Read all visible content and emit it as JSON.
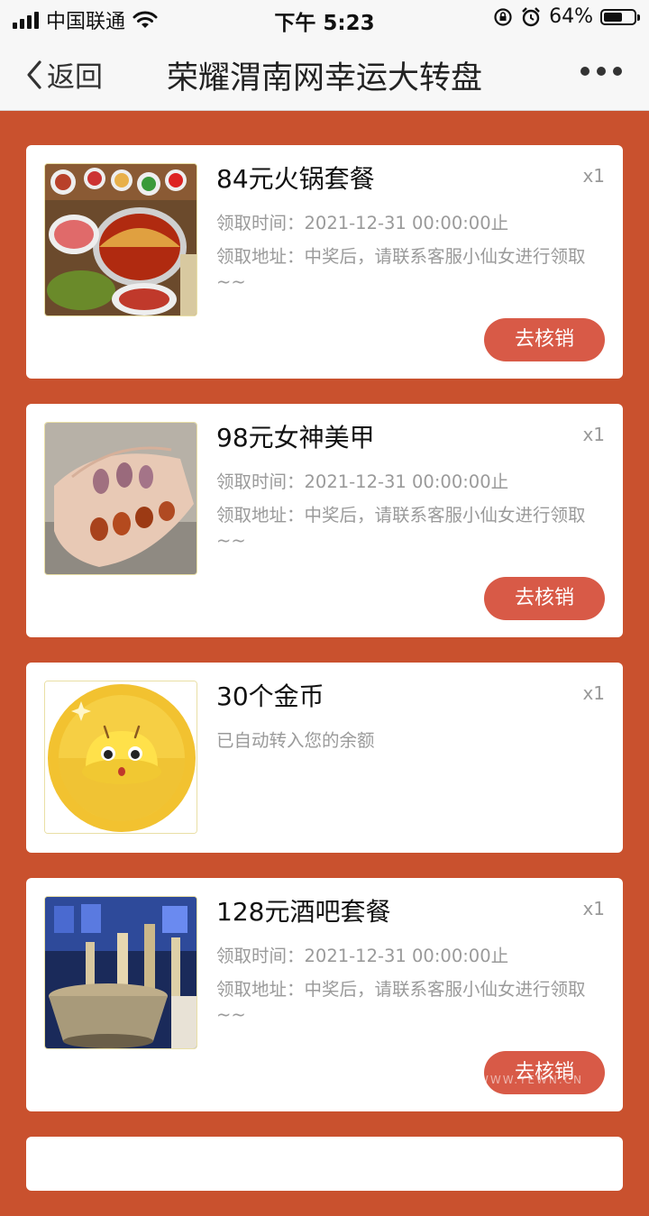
{
  "status_bar": {
    "carrier": "中国联通",
    "time": "下午 5:23",
    "battery_percent": "64%",
    "battery_level": 0.64,
    "icons": [
      "signal-icon",
      "wifi-icon",
      "rotation-lock-icon",
      "alarm-icon",
      "battery-icon"
    ]
  },
  "nav": {
    "back_label": "返回",
    "title": "荣耀渭南网幸运大转盘",
    "more_icon": "more-dots-icon"
  },
  "prizes": [
    {
      "title": "84元火锅套餐",
      "qty": "x1",
      "time_line": "领取时间：2021-12-31 00:00:00止",
      "address_line": "领取地址：中奖后，请联系客服小仙女进行领取~~",
      "button": "去核销",
      "image": "hotpot-image"
    },
    {
      "title": "98元女神美甲",
      "qty": "x1",
      "time_line": "领取时间：2021-12-31 00:00:00止",
      "address_line": "领取地址：中奖后，请联系客服小仙女进行领取~~",
      "button": "去核销",
      "image": "manicure-image"
    },
    {
      "title": "30个金币",
      "qty": "x1",
      "note": "已自动转入您的余额",
      "image": "gold-coin-image"
    },
    {
      "title": "128元酒吧套餐",
      "qty": "x1",
      "time_line": "领取时间：2021-12-31 00:00:00止",
      "address_line": "领取地址：中奖后，请联系客服小仙女进行领取~~",
      "button": "去核销",
      "image": "bar-drinks-image"
    }
  ],
  "watermark": "WWW.YEWN.CN",
  "colors": {
    "background": "#C9512E",
    "button": "#D85A47"
  }
}
